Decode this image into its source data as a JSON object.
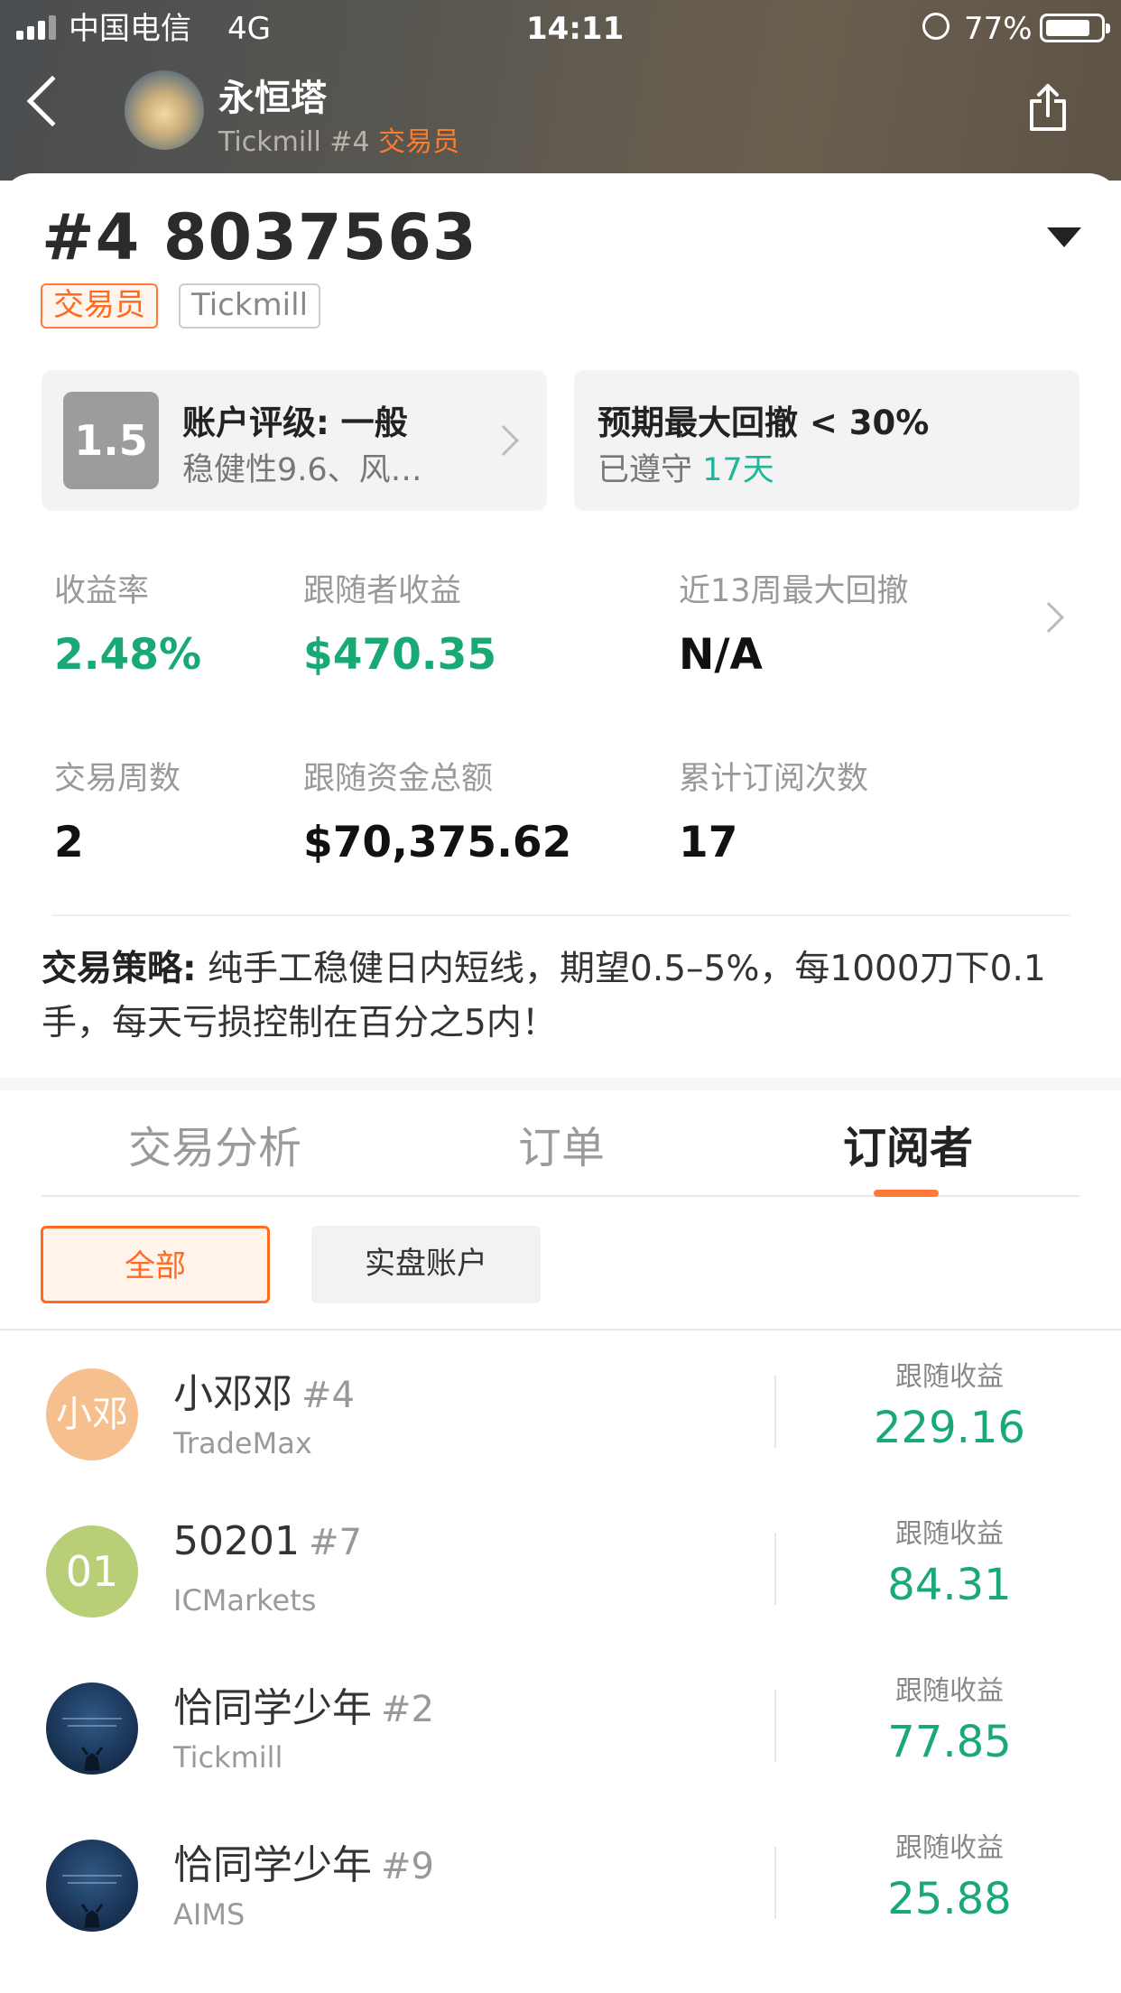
{
  "status_bar": {
    "carrier": "中国电信",
    "network": "4G",
    "time": "14:11",
    "battery": "77%",
    "battery_level": 0.77
  },
  "header": {
    "title": "永恒塔",
    "broker": "Tickmill",
    "rank": "#4",
    "role": "交易员"
  },
  "account": {
    "number": "#4 8037563",
    "tags": [
      "交易员",
      "Tickmill"
    ]
  },
  "rating": {
    "score": "1.5",
    "title": "账户评级: 一般",
    "detail": "稳健性9.6、风…"
  },
  "drawdown": {
    "title": "预期最大回撤 < 30%",
    "kept_prefix": "已遵守",
    "kept_days": "17天"
  },
  "stats": [
    {
      "label": "收益率",
      "value": "2.48%"
    },
    {
      "label": "跟随者收益",
      "value": "$470.35"
    },
    {
      "label": "近13周最大回撤",
      "value": "N/A"
    },
    {
      "label": "交易周数",
      "value": "2"
    },
    {
      "label": "跟随资金总额",
      "value": "$70,375.62"
    },
    {
      "label": "累计订阅次数",
      "value": "17"
    }
  ],
  "strategy": {
    "label": "交易策略:",
    "text": "纯手工稳健日内短线，期望0.5–5%，每1000刀下0.1手，每天亏损控制在百分之5内！"
  },
  "tabs": [
    "交易分析",
    "订单",
    "订阅者"
  ],
  "filters": [
    "全部",
    "实盘账户"
  ],
  "subscribers": [
    {
      "avatar": "小邓",
      "avatar_color": "#f6c08e",
      "name": "小邓邓",
      "rank": "#4",
      "broker": "TradeMax",
      "label": "跟随收益",
      "value": "229.16"
    },
    {
      "avatar": "01",
      "avatar_color": "#b8cf77",
      "name": "50201",
      "rank": "#7",
      "broker": "ICMarkets",
      "label": "跟随收益",
      "value": "84.31"
    },
    {
      "avatar": "",
      "avatar_color": "#1a3456",
      "name": "恰同学少年",
      "rank": "#2",
      "broker": "Tickmill",
      "label": "跟随收益",
      "value": "77.85"
    },
    {
      "avatar": "",
      "avatar_color": "#1a3456",
      "name": "恰同学少年",
      "rank": "#9",
      "broker": "AIMS",
      "label": "跟随收益",
      "value": "25.88"
    }
  ]
}
